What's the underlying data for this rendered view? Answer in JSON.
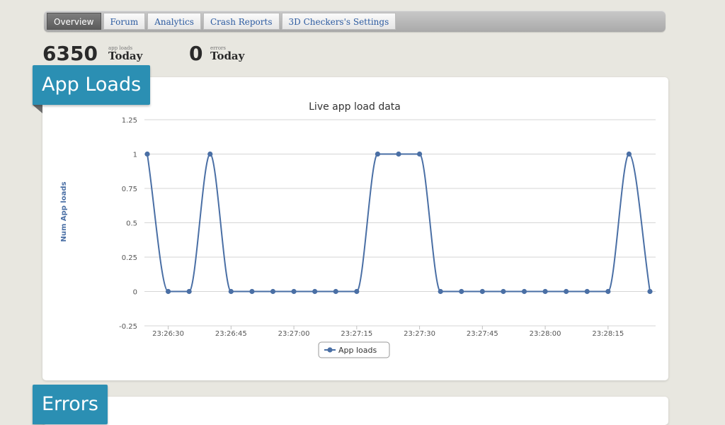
{
  "tabs": [
    {
      "label": "Overview",
      "active": true
    },
    {
      "label": "Forum",
      "active": false
    },
    {
      "label": "Analytics",
      "active": false
    },
    {
      "label": "Crash Reports",
      "active": false
    },
    {
      "label": "3D Checkers's Settings",
      "active": false
    }
  ],
  "stats": {
    "app_loads": {
      "value": "6350",
      "caption": "app loads",
      "period": "Today"
    },
    "errors": {
      "value": "0",
      "caption": "errors",
      "period": "Today"
    }
  },
  "sections": {
    "app_loads_title": "App Loads",
    "errors_title": "Errors"
  },
  "colors": {
    "accent": "#2b8fb3",
    "series": "#4a6fa5",
    "tab_link": "#2b5aa0"
  },
  "chart_data": {
    "type": "line",
    "title": "Live app load data",
    "ylabel": "Num App loads",
    "xlabel": "",
    "ylim": [
      -0.25,
      1.25
    ],
    "yticks": [
      "1.25",
      "1",
      "0.75",
      "0.5",
      "0.25",
      "0",
      "-0.25"
    ],
    "xticks": [
      "23:26:30",
      "23:26:45",
      "23:27:00",
      "23:27:15",
      "23:27:30",
      "23:27:45",
      "23:28:00",
      "23:28:15"
    ],
    "grid": true,
    "legend": "bottom-center",
    "series": [
      {
        "name": "App loads",
        "x": [
          "23:26:25",
          "23:26:30",
          "23:26:35",
          "23:26:40",
          "23:26:45",
          "23:26:50",
          "23:26:55",
          "23:27:00",
          "23:27:05",
          "23:27:10",
          "23:27:15",
          "23:27:20",
          "23:27:25",
          "23:27:30",
          "23:27:35",
          "23:27:40",
          "23:27:45",
          "23:27:50",
          "23:27:55",
          "23:28:00",
          "23:28:05",
          "23:28:10",
          "23:28:15",
          "23:28:20",
          "23:28:25"
        ],
        "values": [
          1,
          0,
          0,
          1,
          0,
          0,
          0,
          0,
          0,
          0,
          0,
          1,
          1,
          1,
          0,
          0,
          0,
          0,
          0,
          0,
          0,
          0,
          0,
          1,
          0
        ]
      }
    ]
  }
}
